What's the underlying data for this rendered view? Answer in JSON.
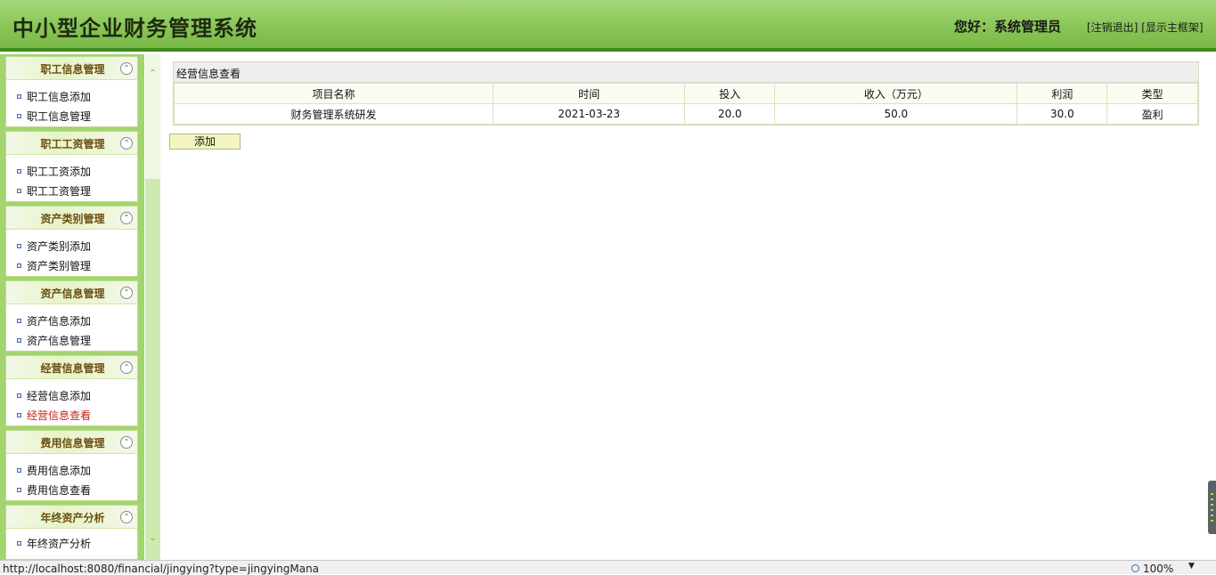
{
  "header": {
    "title": "中小型企业财务管理系统",
    "greeting": "您好：",
    "user": "系统管理员",
    "logout": "[注销退出]",
    "show_frame": "[显示主框架]"
  },
  "sidebar": {
    "panels": [
      {
        "title": "职工信息管理",
        "items": [
          "职工信息添加",
          "职工信息管理"
        ]
      },
      {
        "title": "职工工资管理",
        "items": [
          "职工工资添加",
          "职工工资管理"
        ]
      },
      {
        "title": "资产类别管理",
        "items": [
          "资产类别添加",
          "资产类别管理"
        ]
      },
      {
        "title": "资产信息管理",
        "items": [
          "资产信息添加",
          "资产信息管理"
        ]
      },
      {
        "title": "经营信息管理",
        "items": [
          "经营信息添加",
          "经营信息查看"
        ]
      },
      {
        "title": "费用信息管理",
        "items": [
          "费用信息添加",
          "费用信息查看"
        ]
      },
      {
        "title": "年终资产分析",
        "items": [
          "年终资产分析"
        ]
      }
    ],
    "active_item": "经营信息查看",
    "collapse_icon": "double-chevron-up-icon"
  },
  "main": {
    "section_title": "经营信息查看",
    "columns": [
      "项目名称",
      "时间",
      "投入",
      "收入（万元）",
      "利润",
      "类型"
    ],
    "rows": [
      [
        "财务管理系统研发",
        "2021-03-23",
        "20.0",
        "50.0",
        "30.0",
        "盈利"
      ]
    ],
    "add_button": "添加"
  },
  "statusbar": {
    "url": "http://localhost:8080/financial/jingying?type=jingyingMana",
    "zoom": "100%"
  },
  "colors": {
    "header_green": "#89c557",
    "header_border": "#3f8a1e",
    "sidebar_green": "#a3d46e",
    "panel_title": "#6b4e12",
    "active_link": "#c0271d"
  }
}
